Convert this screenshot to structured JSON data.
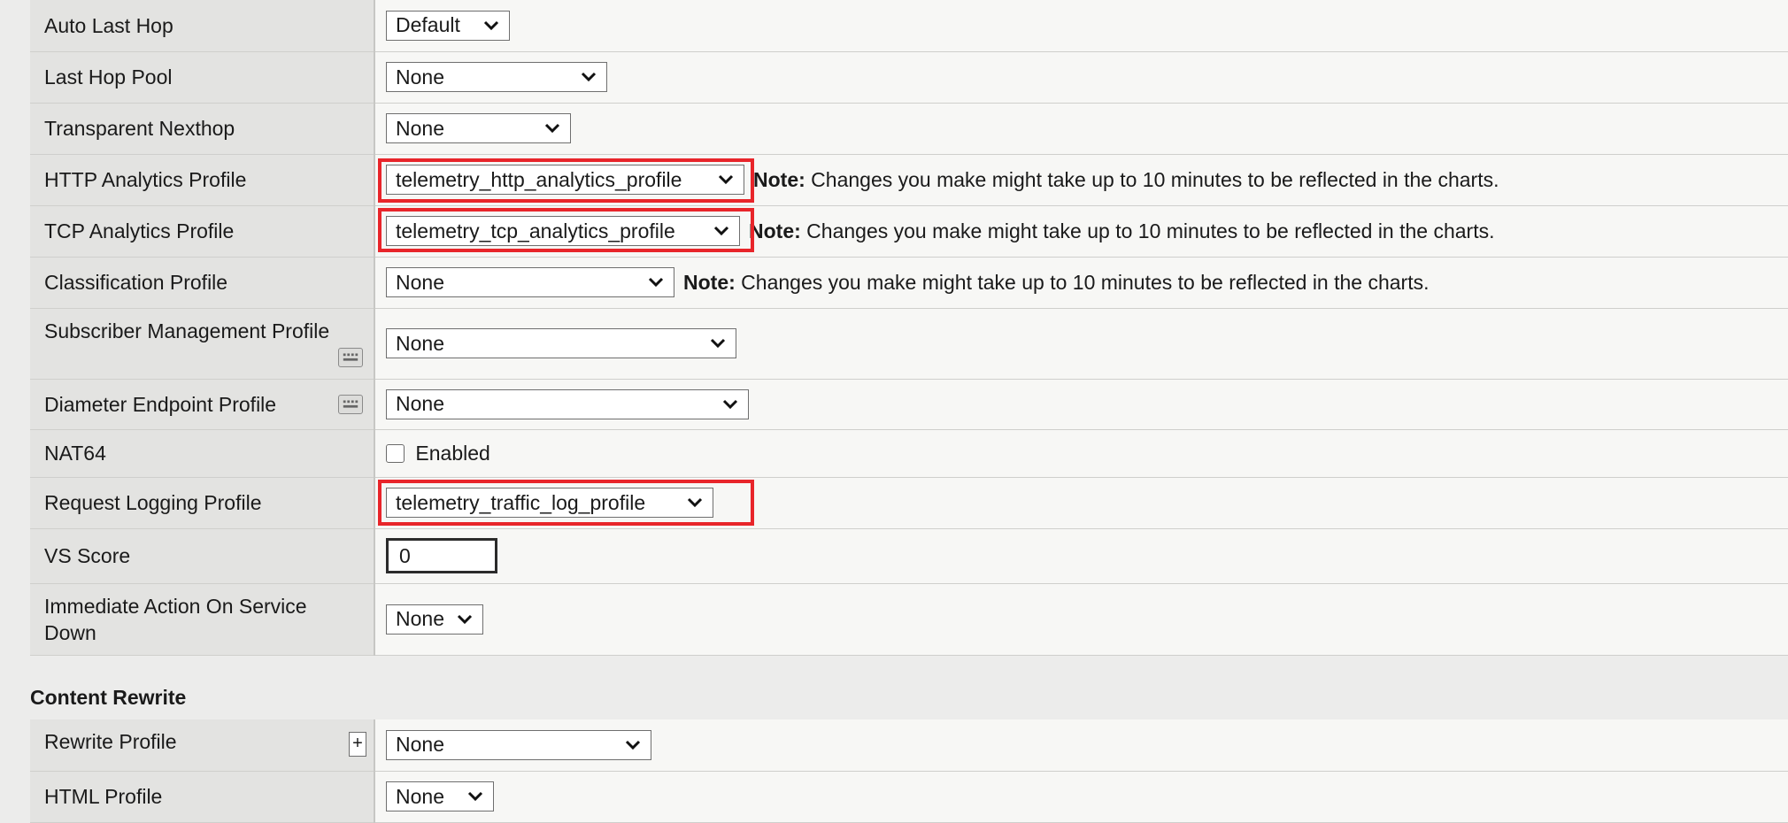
{
  "rows": [
    {
      "label": "Auto Last Hop",
      "select": "Default"
    },
    {
      "label": "Last Hop Pool",
      "select": "None"
    },
    {
      "label": "Transparent Nexthop",
      "select": "None"
    },
    {
      "label": "HTTP Analytics Profile",
      "select": "telemetry_http_analytics_profile",
      "note_bold": "Note:",
      "note": " Changes you make might take up to 10 minutes to be reflected in the charts."
    },
    {
      "label": "TCP Analytics Profile",
      "select": "telemetry_tcp_analytics_profile",
      "note_bold": "Note:",
      "note": " Changes you make might take up to 10 minutes to be reflected in the charts."
    },
    {
      "label": "Classification Profile",
      "select": "None",
      "note_bold": "Note:",
      "note": " Changes you make might take up to 10 minutes to be reflected in the charts."
    },
    {
      "label": "Subscriber Management Profile",
      "select": "None"
    },
    {
      "label": "Diameter Endpoint Profile",
      "select": "None"
    },
    {
      "label": "NAT64",
      "checkbox_label": "Enabled"
    },
    {
      "label": "Request Logging Profile",
      "select": "telemetry_traffic_log_profile"
    },
    {
      "label": "VS Score",
      "input_value": "0"
    },
    {
      "label_line1": "Immediate Action On Service",
      "label_line2": "Down",
      "select": "None"
    }
  ],
  "content_rewrite": {
    "title": "Content Rewrite",
    "rows": [
      {
        "label": "Rewrite Profile",
        "select": "None",
        "plus": "+"
      },
      {
        "label": "HTML Profile",
        "select": "None"
      }
    ]
  },
  "colors": {
    "highlight": "#e8252a"
  }
}
